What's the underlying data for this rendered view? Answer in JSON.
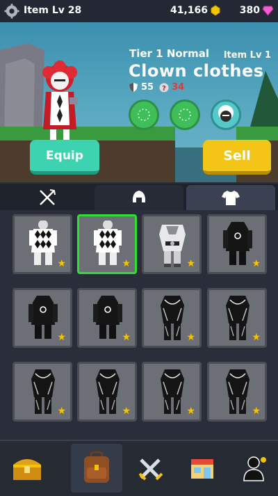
{
  "header": {
    "item_level": "Item Lv 28",
    "gold": "41,166",
    "gems": "380"
  },
  "detail": {
    "tier": "Tier 1 Normal",
    "item_level": "Item Lv 1",
    "name": "Clown clothes",
    "defense": "55",
    "penalty": "34",
    "equip_label": "Equip",
    "sell_label": "Sell"
  },
  "tabs": [
    {
      "name": "weapons",
      "icon": "crossed-weapons-icon"
    },
    {
      "name": "helmet",
      "icon": "helmet-icon"
    },
    {
      "name": "clothes",
      "icon": "shirt-icon",
      "active": true
    }
  ],
  "inventory": [
    {
      "type": "clown",
      "stars": 1
    },
    {
      "type": "clown",
      "stars": 1,
      "selected": true
    },
    {
      "type": "armor-white",
      "stars": 1
    },
    {
      "type": "hoodie",
      "stars": 1
    },
    {
      "type": "hoodie",
      "stars": 1
    },
    {
      "type": "hoodie",
      "stars": 1
    },
    {
      "type": "suit",
      "stars": 1
    },
    {
      "type": "suit",
      "stars": 1
    },
    {
      "type": "suit",
      "stars": 1
    },
    {
      "type": "suit",
      "stars": 1
    },
    {
      "type": "suit",
      "stars": 1
    },
    {
      "type": "suit",
      "stars": 1
    }
  ],
  "bottom_nav": [
    {
      "icon": "treasure-chest-icon"
    },
    {
      "icon": "backpack-icon",
      "active": true
    },
    {
      "icon": "crossed-swords-icon"
    },
    {
      "icon": "shop-icon"
    },
    {
      "icon": "character-icon"
    }
  ]
}
